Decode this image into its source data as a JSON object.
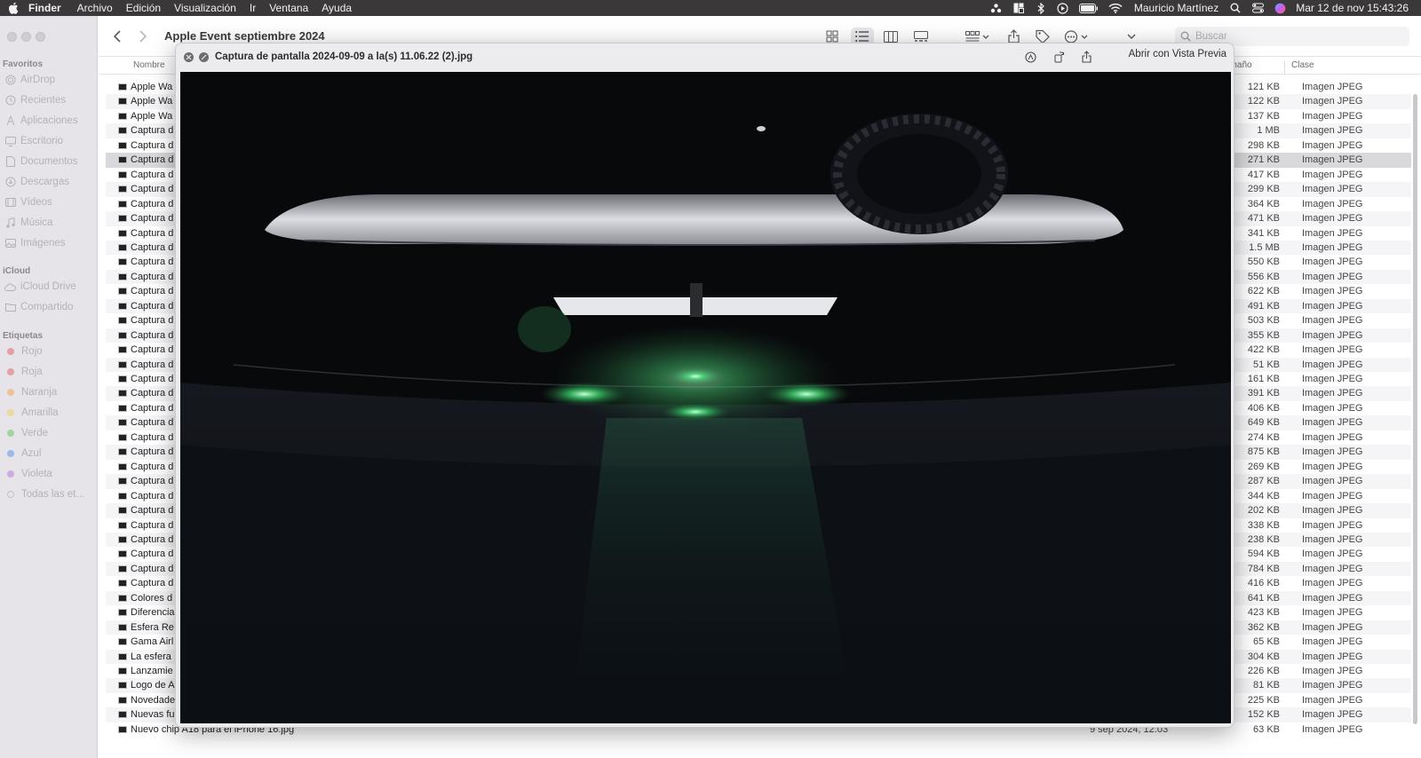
{
  "menubar": {
    "app_name": "Finder",
    "menus": [
      "Archivo",
      "Edición",
      "Visualización",
      "Ir",
      "Ventana",
      "Ayuda"
    ],
    "user_name": "Mauricio Martínez",
    "clock": "Mar 12 de nov  15:43:26",
    "status_icons": [
      "dropbox-icon",
      "layout-icon",
      "bluetooth-icon",
      "play-icon",
      "battery-icon",
      "wifi-icon",
      "search-icon",
      "control-center-icon",
      "siri-icon"
    ]
  },
  "sidebar": {
    "sections": {
      "favorites": "Favoritos",
      "icloud": "iCloud",
      "tags": "Etiquetas"
    },
    "favorites": [
      "AirDrop",
      "Recientes",
      "Aplicaciones",
      "Escritorio",
      "Documentos",
      "Descargas",
      "Vídeos",
      "Música",
      "Imágenes"
    ],
    "icloud_items": [
      "iCloud Drive",
      "Compartido"
    ],
    "tags": [
      {
        "label": "Rojo",
        "color": "#e35b5b"
      },
      {
        "label": "Roja",
        "color": "#e35b5b"
      },
      {
        "label": "Naranja",
        "color": "#f0a24a"
      },
      {
        "label": "Amarilla",
        "color": "#e9cf4a"
      },
      {
        "label": "Verde",
        "color": "#5fc15a"
      },
      {
        "label": "Azul",
        "color": "#4d8fe6"
      },
      {
        "label": "Violeta",
        "color": "#b274d6"
      },
      {
        "label": "Todas las et...",
        "color": ""
      }
    ]
  },
  "toolbar": {
    "title": "Apple Event septiembre 2024",
    "search_placeholder": "Buscar"
  },
  "columns": {
    "name": "Nombre",
    "size": "Tamaño",
    "kind": "Clase"
  },
  "files": [
    {
      "name": "Apple Wa",
      "date": "",
      "size": "121 KB",
      "kind": "Imagen JPEG"
    },
    {
      "name": "Apple Wa",
      "date": "",
      "size": "122 KB",
      "kind": "Imagen JPEG"
    },
    {
      "name": "Apple Wa",
      "date": "",
      "size": "137 KB",
      "kind": "Imagen JPEG"
    },
    {
      "name": "Captura d",
      "date": "",
      "size": "1 MB",
      "kind": "Imagen JPEG"
    },
    {
      "name": "Captura d",
      "date": "",
      "size": "298 KB",
      "kind": "Imagen JPEG"
    },
    {
      "name": "Captura d",
      "date": "",
      "size": "271 KB",
      "kind": "Imagen JPEG"
    },
    {
      "name": "Captura d",
      "date": "",
      "size": "417 KB",
      "kind": "Imagen JPEG"
    },
    {
      "name": "Captura d",
      "date": "",
      "size": "299 KB",
      "kind": "Imagen JPEG"
    },
    {
      "name": "Captura d",
      "date": "",
      "size": "364 KB",
      "kind": "Imagen JPEG"
    },
    {
      "name": "Captura d",
      "date": "",
      "size": "471 KB",
      "kind": "Imagen JPEG"
    },
    {
      "name": "Captura d",
      "date": "",
      "size": "341 KB",
      "kind": "Imagen JPEG"
    },
    {
      "name": "Captura d",
      "date": "",
      "size": "1.5 MB",
      "kind": "Imagen JPEG"
    },
    {
      "name": "Captura d",
      "date": "",
      "size": "550 KB",
      "kind": "Imagen JPEG"
    },
    {
      "name": "Captura d",
      "date": "",
      "size": "556 KB",
      "kind": "Imagen JPEG"
    },
    {
      "name": "Captura d",
      "date": "",
      "size": "622 KB",
      "kind": "Imagen JPEG"
    },
    {
      "name": "Captura d",
      "date": "",
      "size": "491 KB",
      "kind": "Imagen JPEG"
    },
    {
      "name": "Captura d",
      "date": "",
      "size": "503 KB",
      "kind": "Imagen JPEG"
    },
    {
      "name": "Captura d",
      "date": "",
      "size": "355 KB",
      "kind": "Imagen JPEG"
    },
    {
      "name": "Captura d",
      "date": "",
      "size": "422 KB",
      "kind": "Imagen JPEG"
    },
    {
      "name": "Captura d",
      "date": "",
      "size": "51 KB",
      "kind": "Imagen JPEG"
    },
    {
      "name": "Captura d",
      "date": "",
      "size": "161 KB",
      "kind": "Imagen JPEG"
    },
    {
      "name": "Captura d",
      "date": "",
      "size": "391 KB",
      "kind": "Imagen JPEG"
    },
    {
      "name": "Captura d",
      "date": "",
      "size": "406 KB",
      "kind": "Imagen JPEG"
    },
    {
      "name": "Captura d",
      "date": "",
      "size": "649 KB",
      "kind": "Imagen JPEG"
    },
    {
      "name": "Captura d",
      "date": "",
      "size": "274 KB",
      "kind": "Imagen JPEG"
    },
    {
      "name": "Captura d",
      "date": "",
      "size": "875 KB",
      "kind": "Imagen JPEG"
    },
    {
      "name": "Captura d",
      "date": "",
      "size": "269 KB",
      "kind": "Imagen JPEG"
    },
    {
      "name": "Captura d",
      "date": "",
      "size": "287 KB",
      "kind": "Imagen JPEG"
    },
    {
      "name": "Captura d",
      "date": "",
      "size": "344 KB",
      "kind": "Imagen JPEG"
    },
    {
      "name": "Captura d",
      "date": "",
      "size": "202 KB",
      "kind": "Imagen JPEG"
    },
    {
      "name": "Captura d",
      "date": "",
      "size": "338 KB",
      "kind": "Imagen JPEG"
    },
    {
      "name": "Captura d",
      "date": "",
      "size": "238 KB",
      "kind": "Imagen JPEG"
    },
    {
      "name": "Captura d",
      "date": "",
      "size": "594 KB",
      "kind": "Imagen JPEG"
    },
    {
      "name": "Captura d",
      "date": "",
      "size": "784 KB",
      "kind": "Imagen JPEG"
    },
    {
      "name": "Captura d",
      "date": "",
      "size": "416 KB",
      "kind": "Imagen JPEG"
    },
    {
      "name": "Colores d",
      "date": "",
      "size": "641 KB",
      "kind": "Imagen JPEG"
    },
    {
      "name": "Diferencia",
      "date": "",
      "size": "423 KB",
      "kind": "Imagen JPEG"
    },
    {
      "name": "Esfera Re",
      "date": "",
      "size": "362 KB",
      "kind": "Imagen JPEG"
    },
    {
      "name": "Gama Airl",
      "date": "",
      "size": "65 KB",
      "kind": "Imagen JPEG"
    },
    {
      "name": "La esfera",
      "date": "",
      "size": "304 KB",
      "kind": "Imagen JPEG"
    },
    {
      "name": "Lanzamie",
      "date": "",
      "size": "226 KB",
      "kind": "Imagen JPEG"
    },
    {
      "name": "Logo de A",
      "date": "",
      "size": "81 KB",
      "kind": "Imagen JPEG"
    },
    {
      "name": "Novedade",
      "date": "",
      "size": "225 KB",
      "kind": "Imagen JPEG"
    },
    {
      "name": "Nuevas fu",
      "date": "",
      "size": "152 KB",
      "kind": "Imagen JPEG"
    },
    {
      "name": "Nuevo chip A18 para el iPhone 16.jpg",
      "date": "9 sep 2024, 12:03",
      "size": "63 KB",
      "kind": "Imagen JPEG"
    }
  ],
  "selected_row": 5,
  "quicklook": {
    "title": "Captura de pantalla 2024-09-09 a la(s) 11.06.22 (2).jpg",
    "open_with": "Abrir con Vista Previa"
  }
}
